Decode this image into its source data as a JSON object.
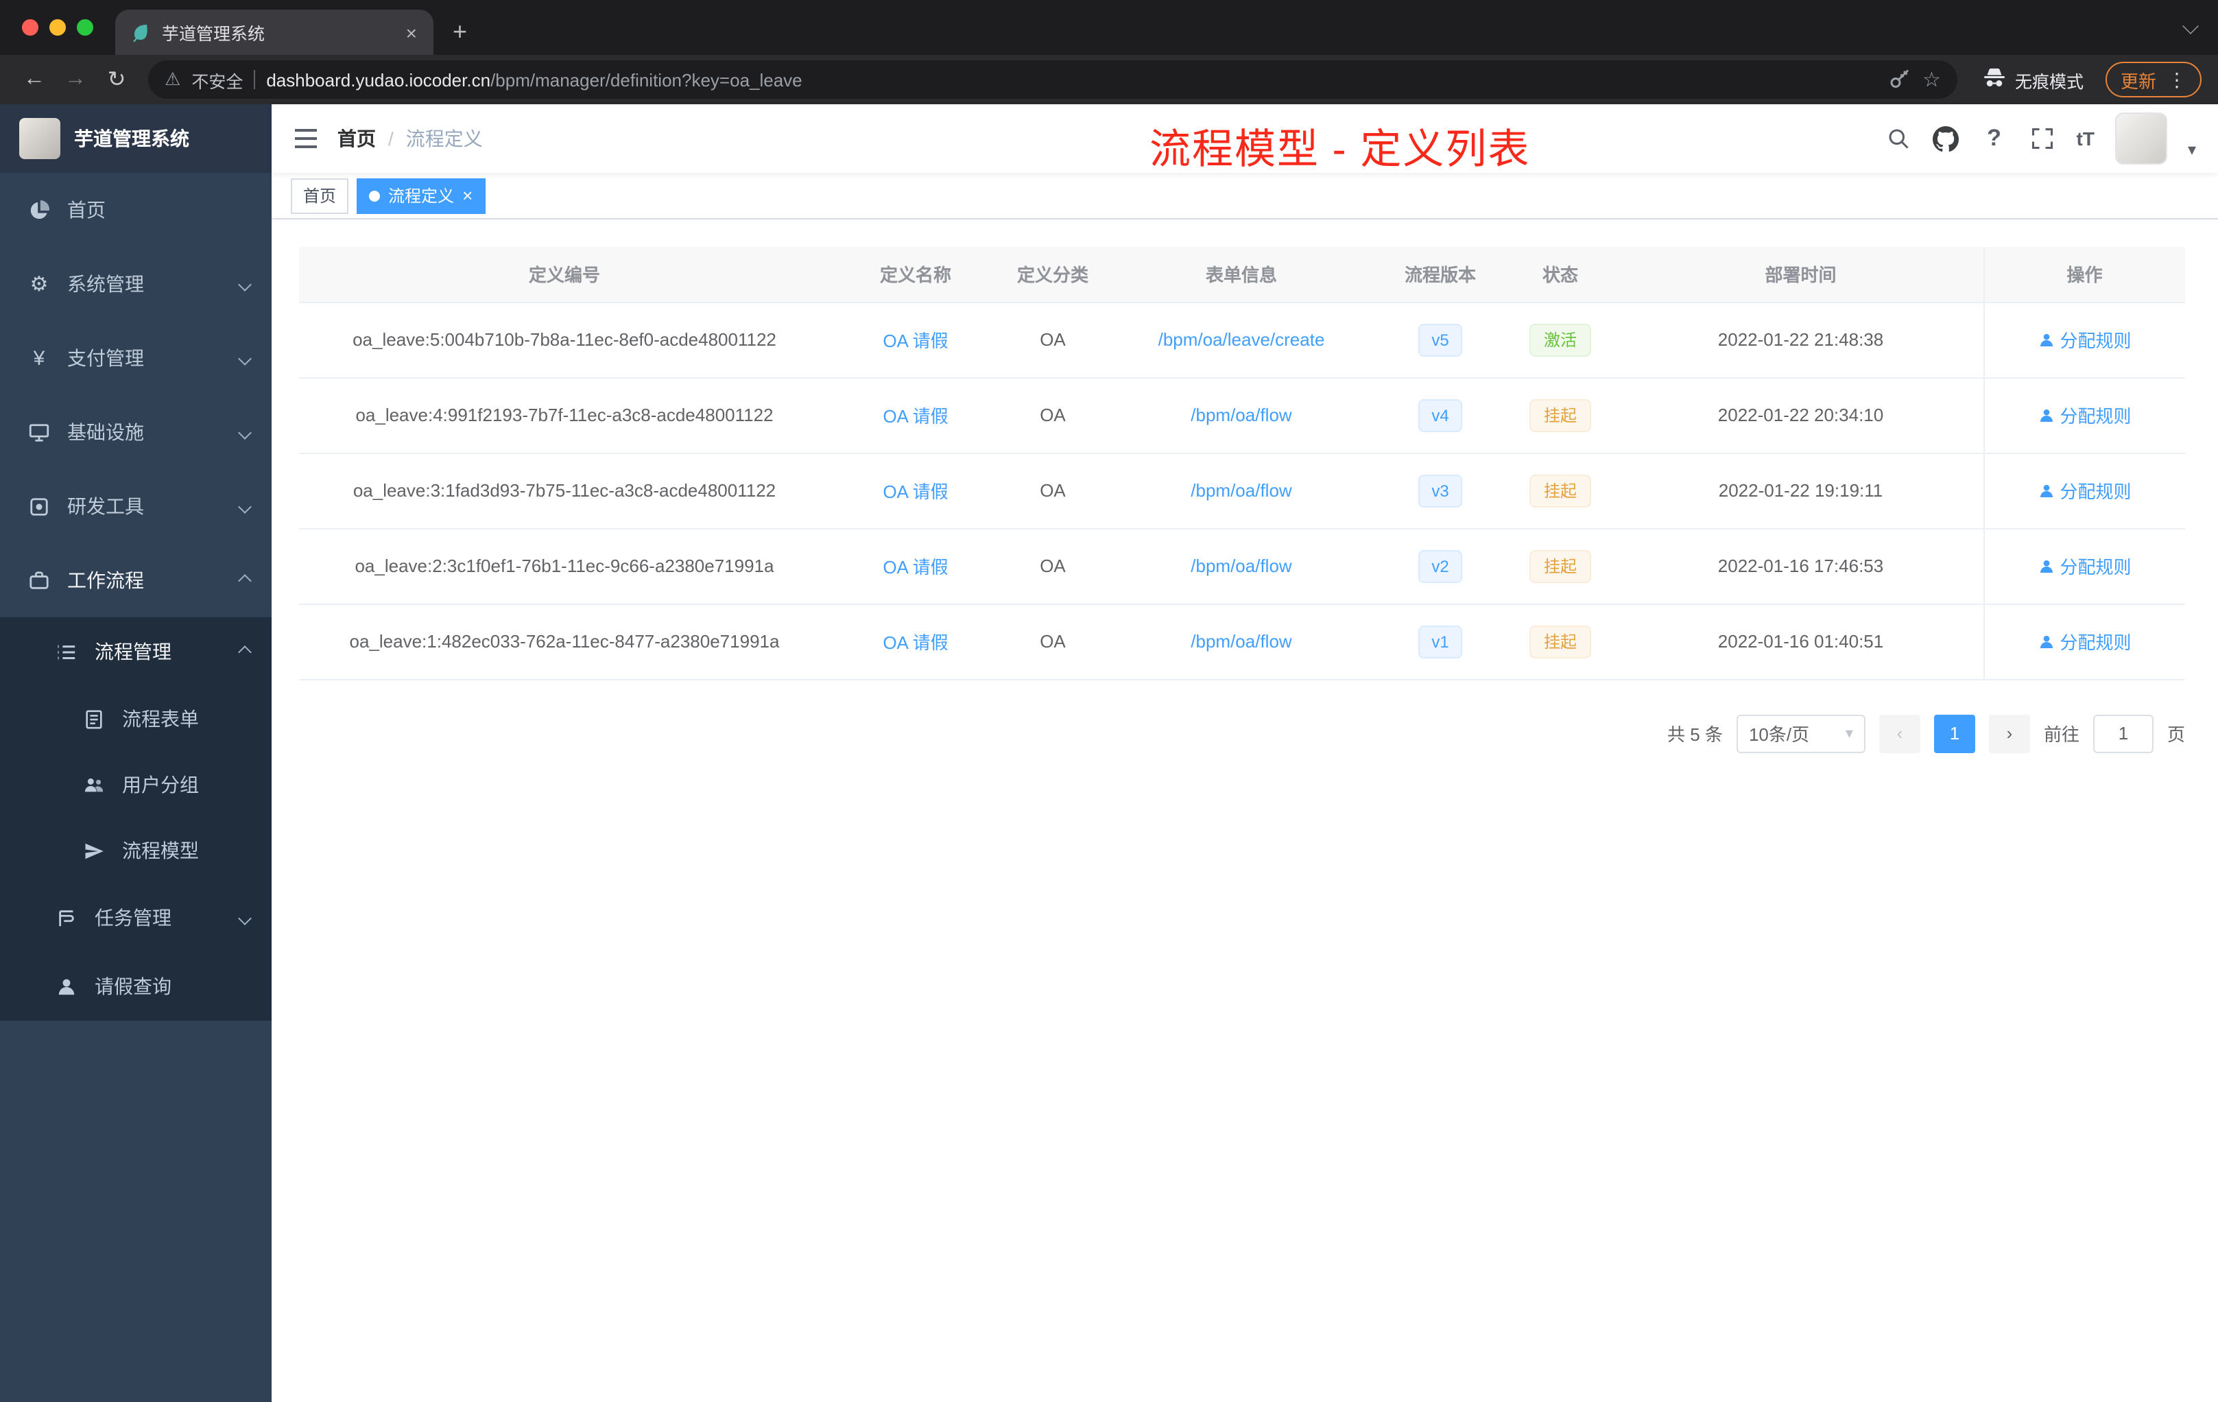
{
  "browser": {
    "tab": {
      "title": "芋道管理系统"
    },
    "address": {
      "security_label": "不安全",
      "url_host": "dashboard.yudao.iocoder.cn",
      "url_path": "/bpm/manager/definition?key=oa_leave",
      "incognito_label": "无痕模式",
      "update_label": "更新"
    }
  },
  "icons": {
    "back": "←",
    "forward": "→",
    "reload": "↻",
    "plus": "+",
    "close": "×",
    "star": "☆",
    "warning": "⚠",
    "more_vertical": "⋮",
    "caret_down": "▾",
    "question": "?",
    "text_size": "tT",
    "prev": "‹",
    "next": "›",
    "yen": "¥",
    "gear": "⚙"
  },
  "colors": {
    "primary": "#409eff",
    "success": "#67c23a",
    "warning": "#e6a23c",
    "annotation_red": "#f8291b",
    "sidebar_bg": "#304156",
    "submenu_bg": "#1f2d3d"
  },
  "sidebar": {
    "title": "芋道管理系统",
    "items": [
      {
        "label": "首页"
      },
      {
        "label": "系统管理"
      },
      {
        "label": "支付管理"
      },
      {
        "label": "基础设施"
      },
      {
        "label": "研发工具"
      },
      {
        "label": "工作流程"
      }
    ],
    "submenu": [
      {
        "label": "流程管理"
      },
      {
        "label": "流程表单"
      },
      {
        "label": "用户分组"
      },
      {
        "label": "流程模型"
      },
      {
        "label": "任务管理"
      },
      {
        "label": "请假查询"
      }
    ]
  },
  "header": {
    "breadcrumb": {
      "home": "首页",
      "separator": "/",
      "current": "流程定义"
    },
    "annotation": "流程模型 - 定义列表"
  },
  "tags": [
    {
      "label": "首页"
    },
    {
      "label": "流程定义"
    }
  ],
  "table": {
    "columns": [
      "定义编号",
      "定义名称",
      "定义分类",
      "表单信息",
      "流程版本",
      "状态",
      "部署时间",
      "操作"
    ],
    "rows": [
      {
        "id": "oa_leave:5:004b710b-7b8a-11ec-8ef0-acde48001122",
        "name": "OA 请假",
        "category": "OA",
        "form": "/bpm/oa/leave/create",
        "version": "v5",
        "status": "激活",
        "time": "2022-01-22 21:48:38",
        "action": "分配规则"
      },
      {
        "id": "oa_leave:4:991f2193-7b7f-11ec-a3c8-acde48001122",
        "name": "OA 请假",
        "category": "OA",
        "form": "/bpm/oa/flow",
        "version": "v4",
        "status": "挂起",
        "time": "2022-01-22 20:34:10",
        "action": "分配规则"
      },
      {
        "id": "oa_leave:3:1fad3d93-7b75-11ec-a3c8-acde48001122",
        "name": "OA 请假",
        "category": "OA",
        "form": "/bpm/oa/flow",
        "version": "v3",
        "status": "挂起",
        "time": "2022-01-22 19:19:11",
        "action": "分配规则"
      },
      {
        "id": "oa_leave:2:3c1f0ef1-76b1-11ec-9c66-a2380e71991a",
        "name": "OA 请假",
        "category": "OA",
        "form": "/bpm/oa/flow",
        "version": "v2",
        "status": "挂起",
        "time": "2022-01-16 17:46:53",
        "action": "分配规则"
      },
      {
        "id": "oa_leave:1:482ec033-762a-11ec-8477-a2380e71991a",
        "name": "OA 请假",
        "category": "OA",
        "form": "/bpm/oa/flow",
        "version": "v1",
        "status": "挂起",
        "time": "2022-01-16 01:40:51",
        "action": "分配规则"
      }
    ]
  },
  "pagination": {
    "total": "共 5 条",
    "page_size": "10条/页",
    "current_page": "1",
    "goto_label": "前往",
    "goto_value": "1",
    "goto_unit": "页"
  }
}
